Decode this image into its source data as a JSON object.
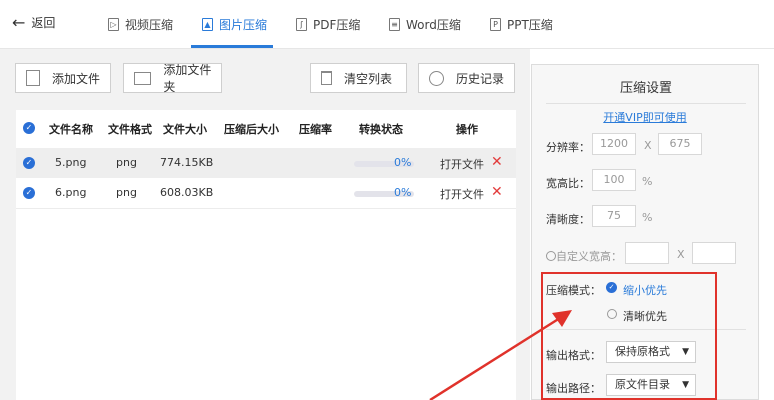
{
  "topbar": {
    "back_label": "返回",
    "tabs": [
      {
        "label": "视频压缩",
        "icon": "video-icon"
      },
      {
        "label": "图片压缩",
        "icon": "image-icon"
      },
      {
        "label": "PDF压缩",
        "icon": "pdf-icon"
      },
      {
        "label": "Word压缩",
        "icon": "word-icon"
      },
      {
        "label": "PPT压缩",
        "icon": "ppt-icon"
      }
    ],
    "active_tab": "图片压缩"
  },
  "toolbar": {
    "add_file": "添加文件",
    "add_folder": "添加文件夹",
    "clear_list": "清空列表",
    "history": "历史记录"
  },
  "table": {
    "headers": [
      "文件名称",
      "文件格式",
      "文件大小",
      "压缩后大小",
      "压缩率",
      "转换状态",
      "操作"
    ],
    "rows": [
      {
        "name": "5.png",
        "format": "png",
        "size": "774.15KB",
        "compressed": "",
        "ratio": "",
        "progress": "0%",
        "action": "打开文件"
      },
      {
        "name": "6.png",
        "format": "png",
        "size": "608.03KB",
        "compressed": "",
        "ratio": "",
        "progress": "0%",
        "action": "打开文件"
      }
    ]
  },
  "settings": {
    "title": "压缩设置",
    "vip_link": "开通VIP即可使用",
    "resolution_label": "分辨率：",
    "resolution_w": "1200",
    "resolution_x": "X",
    "resolution_h": "675",
    "aspect_label": "宽高比：",
    "aspect_value": "100",
    "clarity_label": "清晰度：",
    "clarity_value": "75",
    "percent": "%",
    "custom_label": "自定义宽高：",
    "custom_x": "X",
    "mode_label": "压缩模式：",
    "mode_small": "缩小优先",
    "mode_clear": "清晰优先",
    "format_label": "输出格式：",
    "format_value": "保持原格式",
    "path_label": "输出路径：",
    "path_value": "原文件目录"
  },
  "colors": {
    "accent": "#2a7bd9",
    "highlight_box": "#e0322b"
  }
}
